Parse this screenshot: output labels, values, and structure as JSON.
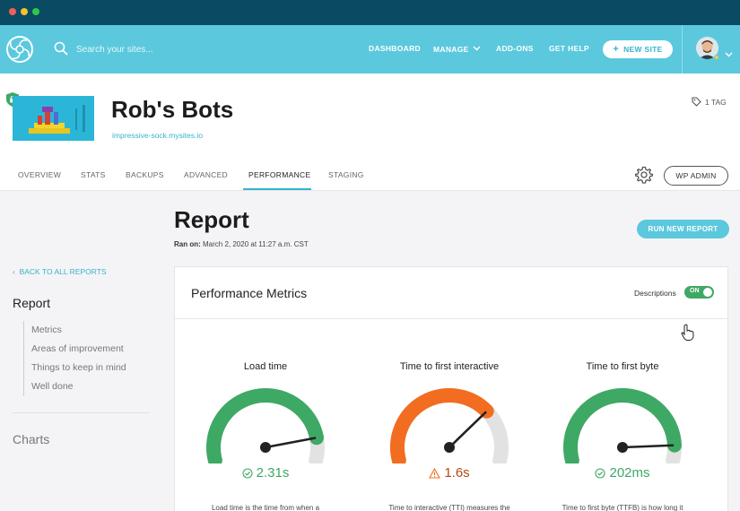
{
  "nav": {
    "search_placeholder": "Search your sites...",
    "items": [
      "DASHBOARD",
      "MANAGE",
      "ADD-ONS",
      "GET HELP"
    ],
    "new_site": "NEW SITE"
  },
  "site": {
    "title": "Rob's Bots",
    "url": "impressive-sock.mysites.io",
    "tag": "1 TAG",
    "tabs": [
      "OVERVIEW",
      "STATS",
      "BACKUPS",
      "ADVANCED",
      "PERFORMANCE",
      "STAGING"
    ],
    "active_tab": "PERFORMANCE",
    "wp_admin": "WP ADMIN"
  },
  "report": {
    "title": "Report",
    "ran_on_label": "Ran on:",
    "ran_on_value": "March 2, 2020 at 11:27 a.m. CST",
    "run_button": "RUN NEW REPORT"
  },
  "sidebar": {
    "back": "BACK TO ALL REPORTS",
    "heading": "Report",
    "items": [
      "Metrics",
      "Areas of improvement",
      "Things to keep in mind",
      "Well done"
    ],
    "charts": "Charts"
  },
  "card": {
    "title": "Performance Metrics",
    "descriptions_label": "Descriptions",
    "toggle": "ON",
    "metrics": [
      {
        "label": "Load time",
        "value": "2.31s",
        "status": "good",
        "color": "#3ea865",
        "desc": "Load time is the time from when a",
        "needle": 0.88
      },
      {
        "label": "Time to first interactive",
        "value": "1.6s",
        "status": "warning",
        "color": "#f26d1f",
        "desc": "Time to interactive (TTI) measures the",
        "needle": 0.72
      },
      {
        "label": "Time to first byte",
        "value": "202ms",
        "status": "good",
        "color": "#3ea865",
        "desc": "Time to first byte (TTFB) is how long it",
        "needle": 0.92
      }
    ]
  },
  "colors": {
    "accent": "#5bc8dd",
    "link": "#36b3cc",
    "good": "#3ea865",
    "warning": "#f26d1f",
    "track": "#e2e2e2"
  }
}
